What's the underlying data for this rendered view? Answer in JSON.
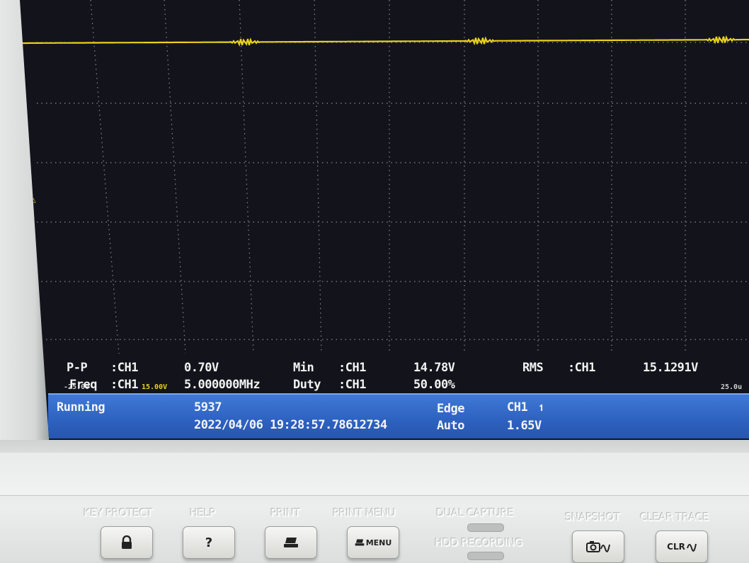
{
  "measurements": {
    "row1": {
      "pp_label": "P-P",
      "pp_ch": ":CH1",
      "pp_value": "0.70V",
      "min_label": "Min",
      "min_ch": ":CH1",
      "min_value": "14.78V",
      "rms_label": "RMS",
      "rms_ch": ":CH1",
      "rms_value": "15.1291V"
    },
    "row2": {
      "freq_label": "Freq",
      "freq_ch": ":CH1",
      "freq_value": "5.000000MHz",
      "duty_label": "Duty",
      "duty_ch": ":CH1",
      "duty_value": "50.00%"
    },
    "offset_label": "-25.00",
    "ch_scale": "15.00V",
    "timebase": "25.0u"
  },
  "status_bar": {
    "state": "Running",
    "acq_count": "5937",
    "datetime": "2022/04/06 19:28:57.78612734",
    "trigger_type": "Edge",
    "trigger_source": "CH1",
    "trigger_mode": "Auto",
    "trigger_level": "1.65V"
  },
  "front_panel": {
    "labels": {
      "key_protect": "KEY PROTECT",
      "help": "HELP",
      "print": "PRINT",
      "print_menu": "PRINT MENU",
      "dual_capture": "DUAL CAPTURE",
      "hdd_recording": "HDD RECORDING",
      "snapshot": "SNAPSHOT",
      "clear_trace": "CLEAR TRACE"
    },
    "buttons": {
      "help": "?",
      "print_menu": "MENU",
      "clear_trace": "CLR"
    }
  },
  "colors": {
    "trace": "#e8d21a",
    "screen_bg": "#13131c",
    "status_bar": "#2f63c2"
  },
  "icons": [
    "lock-icon",
    "printer-icon",
    "camera-icon",
    "rising-edge-icon",
    "trigger-level-icon"
  ]
}
